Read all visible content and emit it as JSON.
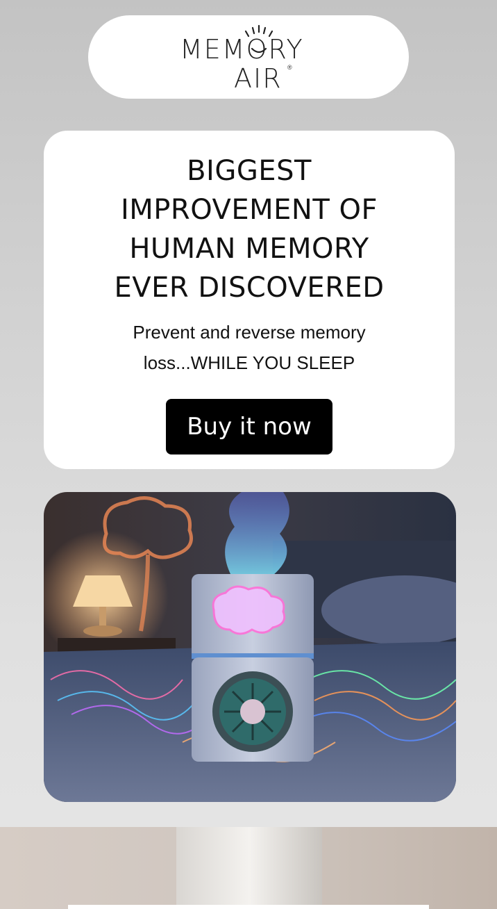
{
  "logo": {
    "line1": "MEMORY",
    "line2": "AIR",
    "registered": "®"
  },
  "hero": {
    "title": "BIGGEST\nIMPROVEMENT OF\nHUMAN MEMORY\nEVER DISCOVERED",
    "subtitle": "Prevent and reverse memory\nloss...WHILE YOU SLEEP",
    "cta_label": "Buy it now"
  },
  "images": {
    "product": "memory-air-device-bedroom-image",
    "next_section": "product-closeup-image"
  },
  "colors": {
    "page_background": "#c8c8c8",
    "card": "#ffffff",
    "button": "#000000",
    "button_text": "#ffffff",
    "text": "#111111"
  }
}
